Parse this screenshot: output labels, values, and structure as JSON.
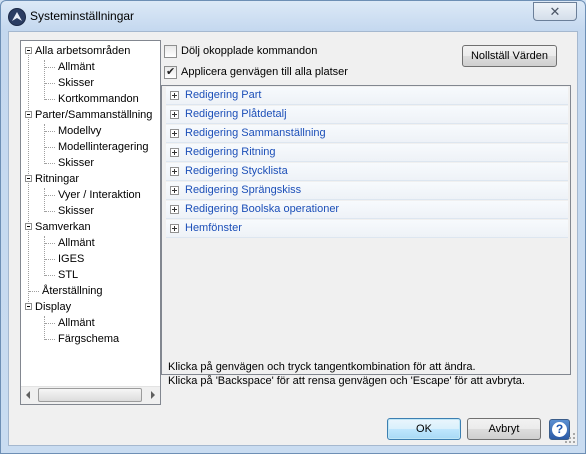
{
  "window": {
    "title": "Systeminställningar",
    "close_glyph": "✕"
  },
  "tree": {
    "items": [
      {
        "label": "Alla arbetsområden"
      },
      {
        "label": "Allmänt"
      },
      {
        "label": "Skisser"
      },
      {
        "label": "Kortkommandon"
      },
      {
        "label": "Parter/Sammanställning"
      },
      {
        "label": "Modellvy"
      },
      {
        "label": "Modellinteragering"
      },
      {
        "label": "Skisser"
      },
      {
        "label": "Ritningar"
      },
      {
        "label": "Vyer / Interaktion"
      },
      {
        "label": "Skisser"
      },
      {
        "label": "Samverkan"
      },
      {
        "label": "Allmänt"
      },
      {
        "label": "IGES"
      },
      {
        "label": "STL"
      },
      {
        "label": "Återställning"
      },
      {
        "label": "Display"
      },
      {
        "label": "Allmänt"
      },
      {
        "label": "Färgschema"
      }
    ]
  },
  "options": {
    "hide_unlinked_label": "Dölj okopplade kommandon",
    "hide_unlinked_checked": false,
    "apply_everywhere_label": "Applicera genvägen till alla platser",
    "apply_everywhere_checked": true
  },
  "reset_button": "Nollställ Värden",
  "categories": [
    "Redigering Part",
    "Redigering Plåtdetalj",
    "Redigering Sammanställning",
    "Redigering Ritning",
    "Redigering Stycklista",
    "Redigering Sprängskiss",
    "Redigering Boolska operationer",
    "Hemfönster"
  ],
  "hints": {
    "line1": "Klicka på genvägen och tryck tangentkombination för att ändra.",
    "line2": "Klicka på 'Backspace' för att rensa genvägen och 'Escape' för att avbryta."
  },
  "buttons": {
    "ok": "OK",
    "cancel": "Avbryt",
    "help": "?"
  }
}
